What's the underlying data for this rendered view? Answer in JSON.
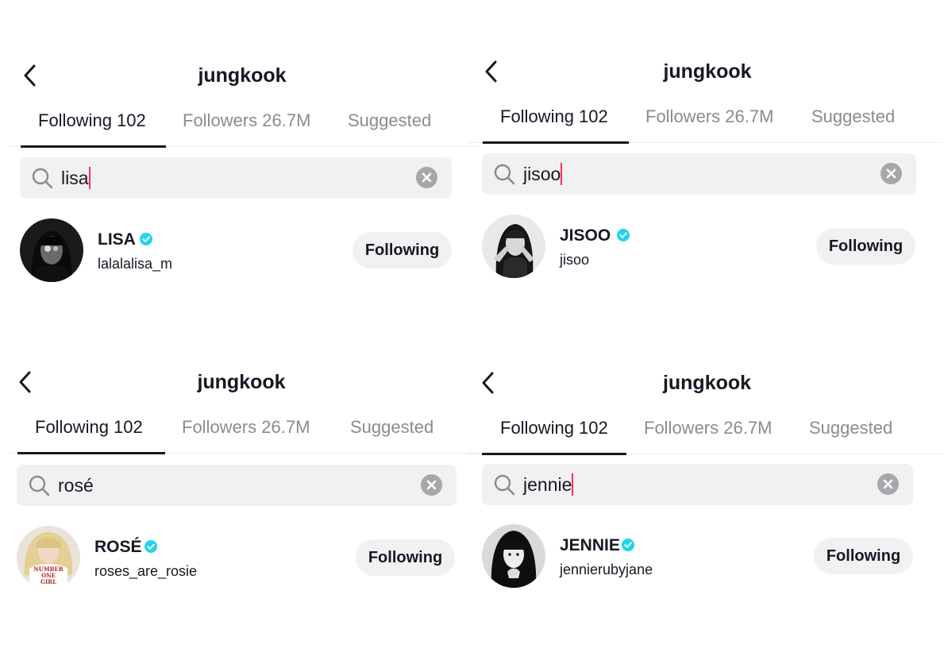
{
  "panels": [
    {
      "header": {
        "title": "jungkook"
      },
      "tabs": [
        {
          "label": "Following 102",
          "active": true
        },
        {
          "label": "Followers 26.7M",
          "active": false
        },
        {
          "label": "Suggested",
          "active": false
        }
      ],
      "search": {
        "value": "lisa"
      },
      "result": {
        "name": "LISA",
        "handle": "lalalalisa_m",
        "button": "Following",
        "verified": true,
        "avatar": "dark-portrait"
      }
    },
    {
      "header": {
        "title": "jungkook"
      },
      "tabs": [
        {
          "label": "Following 102",
          "active": true
        },
        {
          "label": "Followers 26.7M",
          "active": false
        },
        {
          "label": "Suggested",
          "active": false
        }
      ],
      "search": {
        "value": "jisoo"
      },
      "result": {
        "name": "JISOO",
        "handle": "jisoo",
        "button": "Following",
        "verified": true,
        "avatar": "bw-portrait"
      }
    },
    {
      "header": {
        "title": "jungkook"
      },
      "tabs": [
        {
          "label": "Following 102",
          "active": true
        },
        {
          "label": "Followers 26.7M",
          "active": false
        },
        {
          "label": "Suggested",
          "active": false
        }
      ],
      "search": {
        "value": "rosé"
      },
      "result": {
        "name": "ROSÉ",
        "handle": "roses_are_rosie",
        "button": "Following",
        "verified": true,
        "avatar": "blonde-portrait",
        "avatar_shirt_text": [
          "NUMBER",
          "ONE",
          "GIRL"
        ]
      }
    },
    {
      "header": {
        "title": "jungkook"
      },
      "tabs": [
        {
          "label": "Following 102",
          "active": true
        },
        {
          "label": "Followers 26.7M",
          "active": false
        },
        {
          "label": "Suggested",
          "active": false
        }
      ],
      "search": {
        "value": "jennie"
      },
      "result": {
        "name": "JENNIE",
        "handle": "jennierubyjane",
        "button": "Following",
        "verified": true,
        "avatar": "bw-portrait"
      }
    }
  ],
  "colors": {
    "verified": "#20d5ec",
    "caret": "#fe2c55",
    "search_bg": "#f1f1f2",
    "button_bg": "#f1f1f2",
    "muted_text": "#8a8b91"
  }
}
